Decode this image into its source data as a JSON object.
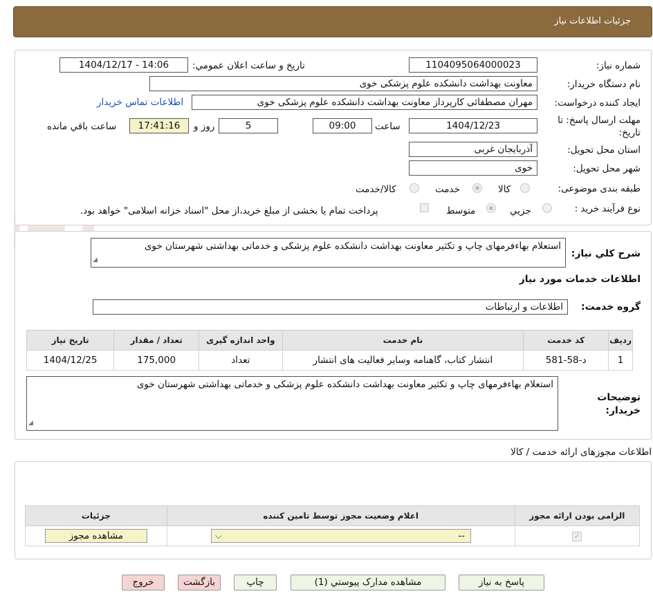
{
  "header": {
    "title": "جزئیات اطلاعات نیاز"
  },
  "form": {
    "need_number_label": "شماره نیاز:",
    "need_number": "1104095064000023",
    "announce_datetime_label": "تاریخ و ساعت اعلان عمومي:",
    "announce_datetime": "1404/12/17 - 14:06",
    "buyer_org_label": "نام دستگاه خريدار:",
    "buyer_org": "معاونت بهداشت دانشکده علوم پزشکی خوی",
    "creator_label": "ايجاد کننده درخواست:",
    "creator": "مهران مصطفائی کارپرداز معاونت بهداشت دانشکده علوم پزشکی خوی",
    "buyer_contact_link": "اطلاعات تماس خريدار",
    "deadline_label_1": "مهلت ارسال پاسخ: تا",
    "deadline_label_2": "تاريخ:",
    "deadline_date": "1404/12/23",
    "time_label": "ساعت",
    "deadline_time": "09:00",
    "days_value": "5",
    "days_label": "روز و",
    "remaining_time": "17:41:16",
    "remaining_label": "ساعت باقي مانده",
    "province_label": "استان محل تحويل:",
    "province": "آذربايجان غربی",
    "city_label": "شهر محل تحويل:",
    "city": "خوی",
    "category_label": "طبقه بندی موضوعی:",
    "category_options": [
      "کالا",
      "خدمت",
      "کالا/خدمت"
    ],
    "category_selected": "خدمت",
    "purchase_type_label": "نوع فرآيند خريد :",
    "purchase_type_options": [
      "جزيي",
      "متوسط"
    ],
    "purchase_type_selected": "متوسط",
    "payment_note": "پرداخت تمام يا بخشی از مبلغ خريد،از محل \"اسناد خزانه اسلامی\" خواهد بود."
  },
  "summary": {
    "label": "شرح کلي نياز:",
    "text": "استعلام بهاءفرمهای چاپ و تکثیر معاونت بهداشت دانشکده علوم پزشکی و خدماتی بهداشتی شهرستان خوی"
  },
  "services": {
    "section_title": "اطلاعات خدمات مورد نياز",
    "group_label": "گروه خدمت:",
    "group_value": "اطلاعات و ارتباطات",
    "columns": [
      "رديف",
      "کد خدمت",
      "نام خدمت",
      "واحد اندازه گيری",
      "تعداد / مقدار",
      "تاريخ نياز"
    ],
    "rows": [
      {
        "row": "1",
        "code": "د-58-581",
        "name": "انتشار کتاب، گاهنامه وساير فعاليت های انتشار",
        "unit": "تعداد",
        "qty": "175,000",
        "date": "1404/12/25"
      }
    ]
  },
  "buyer_notes": {
    "label_1": "توضيحات",
    "label_2": "خريدار:",
    "text": "استعلام بهاءفرمهای چاپ و تکثیر معاونت بهداشت دانشکده علوم پزشکی و خدماتی بهداشتی شهرستان خوی"
  },
  "permits": {
    "title": "اطلاعات مجوزهای ارائه خدمت / کالا",
    "columns": [
      "الزامی بودن ارائه مجوز",
      "اعلام وضعيت مجوز توسط تامين کننده",
      "جزئيات"
    ],
    "select_value": "--",
    "view_button": "مشاهده مجوز"
  },
  "buttons": {
    "reply": "پاسخ به نياز",
    "view_docs": "مشاهده مدارک پيوستي (1)",
    "print": "چاپ",
    "back": "بازگشت",
    "exit": "خروج"
  },
  "watermark": {
    "text": "AriaTender.neT"
  },
  "colors": {
    "header_bg": "#8b6a3e",
    "link": "#1a4fbf",
    "yellow_field": "#f5f3c8",
    "pink_button": "#f6d4d4",
    "green_button": "#eef5e4"
  }
}
